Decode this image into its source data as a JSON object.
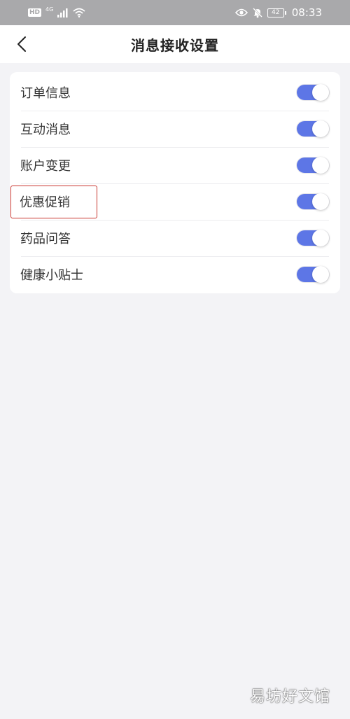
{
  "status_bar": {
    "hd_badge": "HD",
    "network": "4G",
    "battery": "42",
    "time": "08:33",
    "icons": [
      "signal-icon",
      "wifi-icon",
      "eye-icon",
      "mute-icon",
      "battery-icon"
    ]
  },
  "header": {
    "title": "消息接收设置",
    "back_icon": "chevron-left-icon"
  },
  "settings": {
    "items": [
      {
        "label": "订单信息",
        "enabled": true
      },
      {
        "label": "互动消息",
        "enabled": true
      },
      {
        "label": "账户变更",
        "enabled": true
      },
      {
        "label": "优惠促销",
        "enabled": true,
        "highlighted": true
      },
      {
        "label": "药品问答",
        "enabled": true
      },
      {
        "label": "健康小贴士",
        "enabled": true
      }
    ]
  },
  "watermark": {
    "text": "易坊好文馆"
  },
  "colors": {
    "accent": "#5d76e6",
    "highlight_border": "#c8352e",
    "background": "#f3f3f6",
    "status_bar": "#a9a9ab"
  }
}
